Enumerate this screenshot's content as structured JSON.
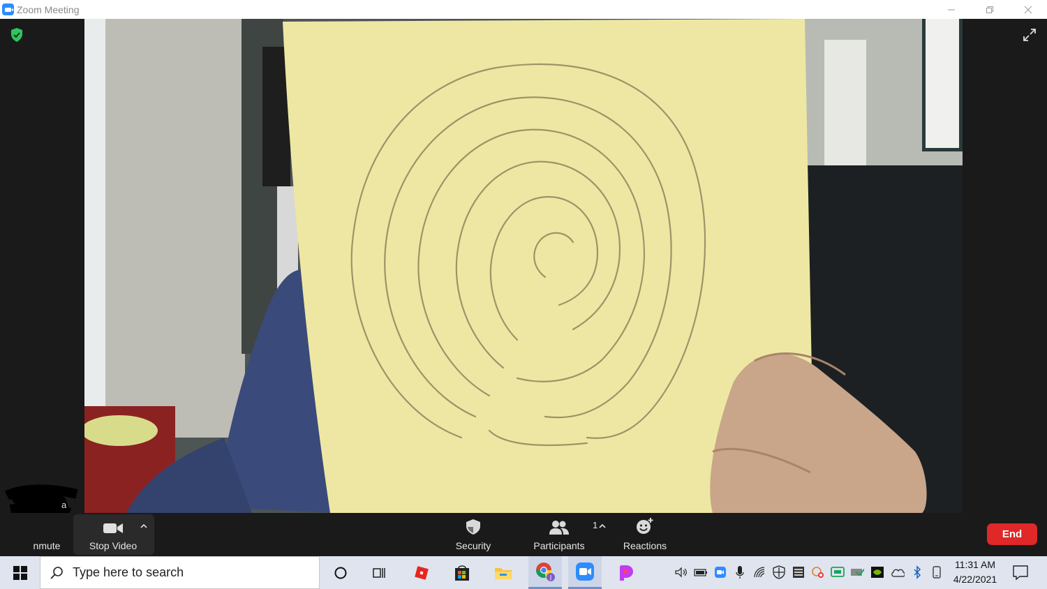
{
  "window": {
    "title": "Zoom Meeting",
    "controls": [
      "minimize",
      "restore",
      "close"
    ]
  },
  "meeting": {
    "security_icon": "shield-check-icon",
    "fullscreen_icon": "fullscreen-icon",
    "participant_name_partial": "a",
    "video_content": "webcam-person-holding-yellow-paper-spiral-drawing"
  },
  "toolbar": {
    "unmute_label": "nmute",
    "stop_video_label": "Stop Video",
    "security_label": "Security",
    "participants_label": "Participants",
    "participants_count": "1",
    "reactions_label": "Reactions",
    "end_label": "End"
  },
  "taskbar": {
    "search_placeholder": "Type here to search",
    "time": "11:31 AM",
    "date": "4/22/2021",
    "apps": [
      "cortana-icon",
      "task-view-icon",
      "roblox-icon",
      "store-icon",
      "file-explorer-icon",
      "chrome-icon",
      "zoom-icon",
      "picsart-icon"
    ]
  },
  "colors": {
    "end_button": "#e02828",
    "shield_green": "#2ec55f",
    "zoom_blue": "#2d8cff"
  }
}
